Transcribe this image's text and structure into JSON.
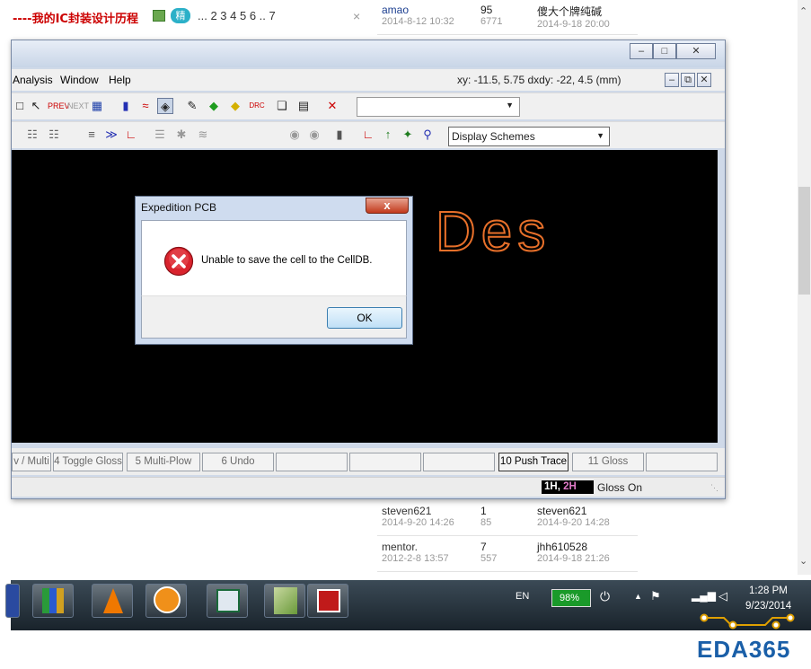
{
  "forum": {
    "thread_title": "----我的IC封装设计历程",
    "new_badge": "精",
    "pages": "... 2 3 4 5 6 .. 7",
    "close_x": "×",
    "row1": {
      "author": "amao",
      "author_date": "2014-8-12 10:32",
      "replies": "95",
      "views": "6771",
      "last_user": "傻大个牌纯碱",
      "last_date": "2014-9-18 20:00"
    },
    "row2": {
      "author": "steven621",
      "author_date": "2014-9-20 14:26",
      "replies": "1",
      "views": "85",
      "last_user": "steven621",
      "last_date": "2014-9-20 14:28"
    },
    "row3": {
      "author": "mentor.",
      "author_date": "2012-2-8 13:57",
      "replies": "7",
      "views": "557",
      "last_user": "jhh610528",
      "last_date": "2014-9-18 21:26"
    }
  },
  "app": {
    "menu": {
      "analysis": "Analysis",
      "window": "Window",
      "help": "Help"
    },
    "coords": "xy: -11.5, 5.75  dxdy: -22, 4.5  (mm)",
    "display_schemes": "Display Schemes",
    "canvas_text": "Des",
    "fn_keys": [
      "v / Multi",
      "4 Toggle Gloss",
      "5 Multi-Plow",
      "6 Undo",
      "",
      "",
      "",
      "10 Push Trace",
      "11 Gloss",
      ""
    ],
    "status_layers_1": "1H",
    "status_layers_sep": ", ",
    "status_layers_2": "2H",
    "status_gloss": "Gloss On"
  },
  "dialog": {
    "title": "Expedition PCB",
    "close_label": "x",
    "message": "Unable to save the cell to the CellDB.",
    "ok_label": "OK"
  },
  "taskbar": {
    "lang": "EN",
    "battery": "98%",
    "time": "1:28 PM",
    "date": "9/23/2014"
  },
  "watermark": "EDA365",
  "colors": {
    "error_red": "#d9232d",
    "canvas_text": "#e8702a",
    "accent": "#1a3d8f"
  }
}
